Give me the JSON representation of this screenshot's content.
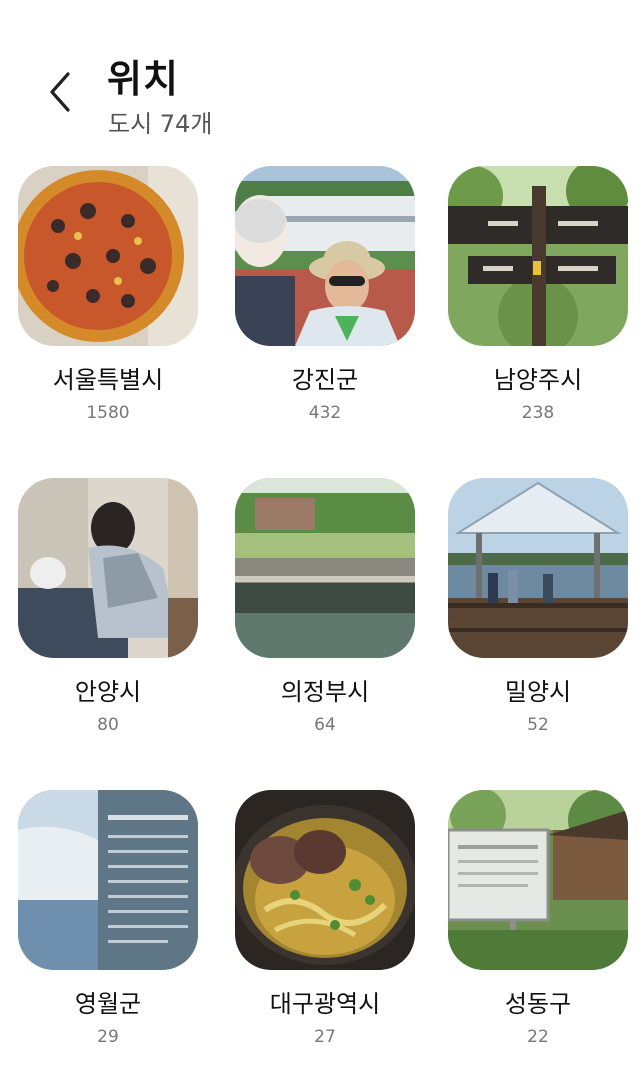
{
  "header": {
    "title": "위치",
    "subtitle": "도시 74개"
  },
  "locations": [
    {
      "name": "서울특별시",
      "count": "1580",
      "thumb": "pizza-photo"
    },
    {
      "name": "강진군",
      "count": "432",
      "thumb": "selfie-photo"
    },
    {
      "name": "남양주시",
      "count": "238",
      "thumb": "trail-sign-photo"
    },
    {
      "name": "안양시",
      "count": "80",
      "thumb": "clinic-photo"
    },
    {
      "name": "의정부시",
      "count": "64",
      "thumb": "stream-photo"
    },
    {
      "name": "밀양시",
      "count": "52",
      "thumb": "pavilion-photo"
    },
    {
      "name": "영월군",
      "count": "29",
      "thumb": "info-board-photo"
    },
    {
      "name": "대구광역시",
      "count": "27",
      "thumb": "soup-photo"
    },
    {
      "name": "성동구",
      "count": "22",
      "thumb": "signboard-photo"
    }
  ],
  "colors": {
    "background": "#ffffff",
    "title": "#111111",
    "subtitle": "#555555",
    "count": "#777777"
  }
}
